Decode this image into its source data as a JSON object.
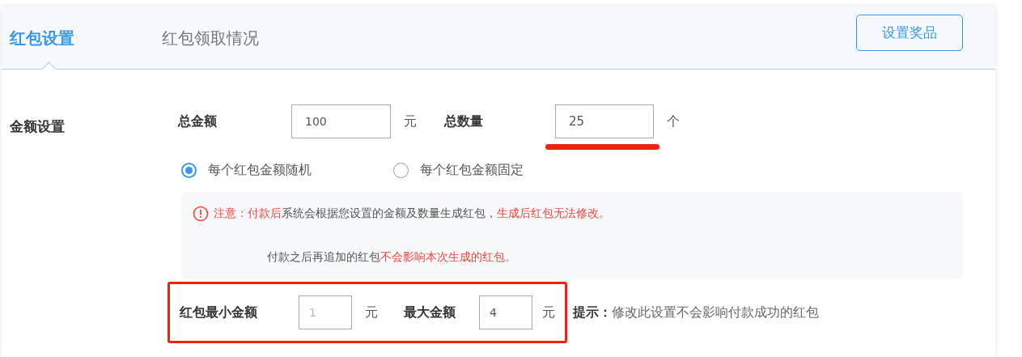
{
  "tabs": [
    {
      "label": "红包设置",
      "selected": true
    },
    {
      "label": "红包领取情况",
      "selected": false
    }
  ],
  "header_button": "设置奖品",
  "section_label": "金额设置",
  "total": {
    "label": "总金额",
    "value": "100",
    "unit": "元"
  },
  "count": {
    "label": "总数量",
    "value": "25",
    "unit": "个",
    "highlighted": true
  },
  "mode_options": [
    {
      "label": "每个红包金额随机",
      "selected": true
    },
    {
      "label": "每个红包金额固定",
      "selected": false
    }
  ],
  "notice": {
    "lines": [
      [
        {
          "text": "注意：",
          "emphasis": true
        },
        {
          "text": "付款后",
          "emphasis": true
        },
        {
          "text": "系统会根据您设置的金额及数量生成红包，",
          "emphasis": false
        },
        {
          "text": "生成后红包无法修改。",
          "emphasis": true
        }
      ],
      [
        {
          "text": "付款之后再追加的红包",
          "emphasis": false
        },
        {
          "text": "不会影响本次生成的红包。",
          "emphasis": true
        }
      ]
    ]
  },
  "range": {
    "highlighted": true,
    "min_label": "红包最小金额",
    "min_placeholder": "1",
    "min_unit": "元",
    "max_label": "最大金额",
    "max_value": "4",
    "max_unit": "元"
  },
  "hint": {
    "label": "提示：",
    "text": "修改此设置不会影响付款成功的红包"
  }
}
